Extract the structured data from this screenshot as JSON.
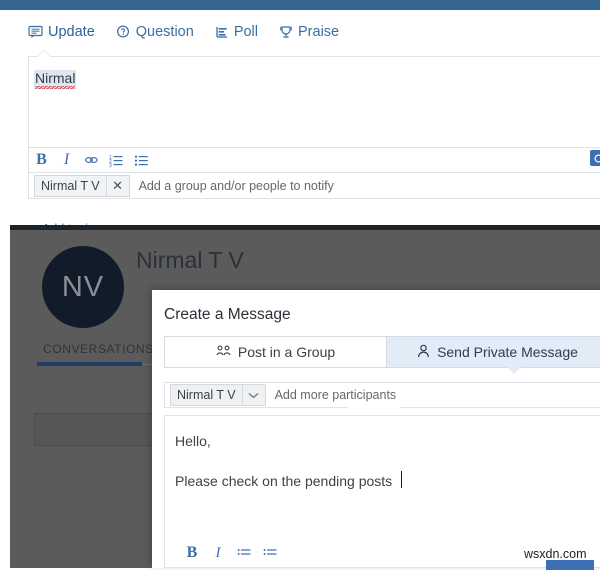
{
  "topbar": {
    "color": "#356690"
  },
  "composer": {
    "post_types": [
      {
        "label": "Update",
        "icon": "speech-bubble-icon",
        "active": true
      },
      {
        "label": "Question",
        "icon": "question-bubble-icon",
        "active": false
      },
      {
        "label": "Poll",
        "icon": "poll-bars-icon",
        "active": false
      },
      {
        "label": "Praise",
        "icon": "trophy-icon",
        "active": false
      }
    ],
    "body_text": "Nirmal",
    "format_buttons": [
      {
        "label": "B",
        "name": "bold-button"
      },
      {
        "label": "I",
        "name": "italic-button"
      },
      {
        "label": "link",
        "name": "link-icon"
      },
      {
        "label": "ordered-list",
        "name": "ordered-list-icon"
      },
      {
        "label": "bullet-list",
        "name": "bullet-list-icon"
      }
    ],
    "notify": {
      "token_label": "Nirmal T V",
      "remove_label": "✕",
      "placeholder": "Add a group and/or people to notify"
    },
    "add_topics_label": "Add topics"
  },
  "group_page": {
    "avatar_initials": "NV",
    "group_name": "Nirmal T V",
    "tab_label": "CONVERSATIONS"
  },
  "modal": {
    "title": "Create a Message",
    "tabs": [
      {
        "label": "Post in a Group",
        "icon": "group-icon",
        "active": false
      },
      {
        "label": "Send Private Message",
        "icon": "person-icon",
        "active": true
      }
    ],
    "participants": {
      "token_label": "Nirmal T V",
      "dropdown_caret": "⌄",
      "placeholder": "Add more participants"
    },
    "message": {
      "line1": "Hello,",
      "line2": "Please check on the pending posts"
    },
    "format_buttons": [
      {
        "label": "B",
        "name": "bold-button"
      },
      {
        "label": "I",
        "name": "italic-button"
      },
      {
        "label": "ordered-list",
        "name": "ordered-list-icon"
      },
      {
        "label": "bullet-list",
        "name": "bullet-list-icon"
      }
    ]
  },
  "watermark": {
    "text": "wsxdn.com"
  }
}
